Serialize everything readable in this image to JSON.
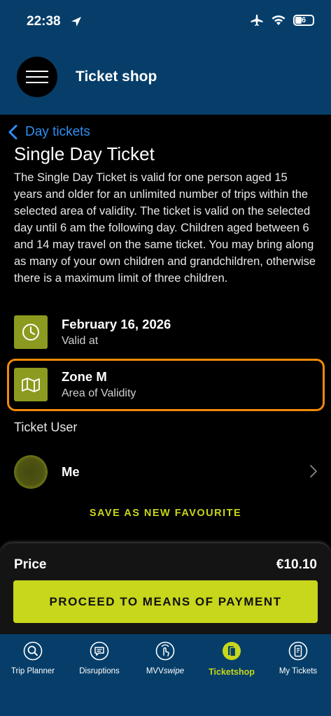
{
  "status_bar": {
    "time": "22:38",
    "battery": "6"
  },
  "header": {
    "title": "Ticket shop"
  },
  "nav": {
    "back_label": "Day tickets"
  },
  "product": {
    "title": "Single Day Ticket",
    "description": "The Single Day Ticket is valid for one person aged 15 years and older for an unlimited number of trips within the selected area of validity. The ticket is valid on the selected day until 6 am the following day. Children aged between 6 and 14 may travel on the same ticket. You may bring along as many of your own children and grandchildren, otherwise there is a maximum limit of three children."
  },
  "validity": {
    "date": "February 16, 2026",
    "label": "Valid at"
  },
  "zone": {
    "name": "Zone M",
    "label": "Area of Validity"
  },
  "ticket_user": {
    "section_label": "Ticket User",
    "name": "Me"
  },
  "favourite": {
    "label": "SAVE AS NEW FAVOURITE"
  },
  "price": {
    "label": "Price",
    "value": "€10.10"
  },
  "payment": {
    "button_label": "PROCEED TO MEANS OF PAYMENT"
  },
  "tabs": [
    {
      "label": "Trip Planner",
      "icon": "search-icon"
    },
    {
      "label": "Disruptions",
      "icon": "message-icon"
    },
    {
      "label": "MVV",
      "label_suffix": "swipe",
      "icon": "swipe-icon"
    },
    {
      "label": "Ticketshop",
      "icon": "tickets-icon",
      "active": true
    },
    {
      "label": "My Tickets",
      "icon": "phone-ticket-icon"
    }
  ],
  "colors": {
    "header_bg": "#063e69",
    "accent": "#c8d61c",
    "link": "#2f8ff0",
    "highlight": "#f18a08",
    "icon_bg": "#8c9a1f"
  }
}
